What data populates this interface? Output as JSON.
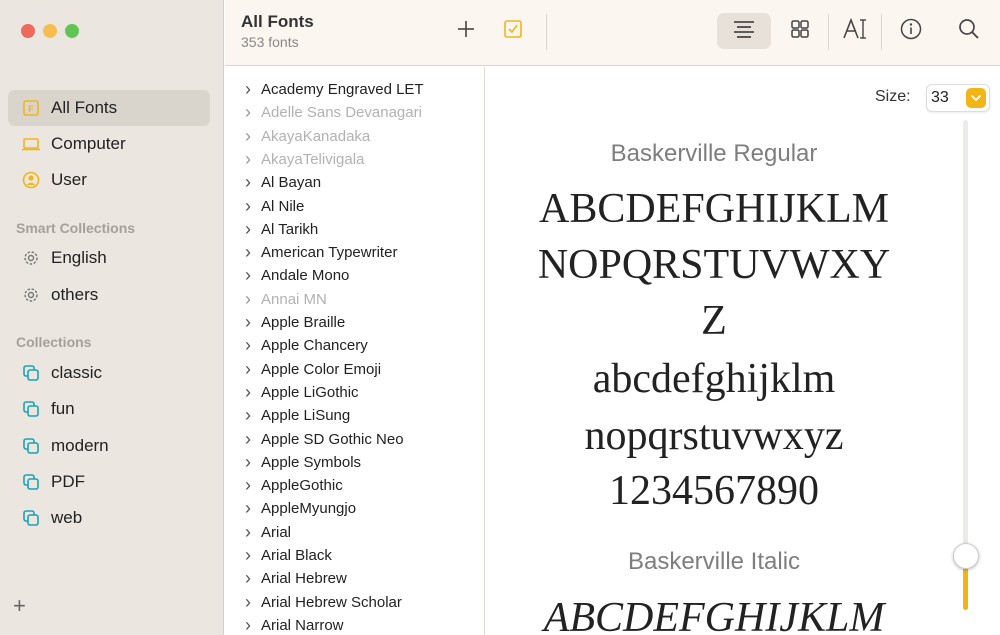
{
  "sidebar": {
    "main": [
      {
        "label": "All Fonts",
        "icon": "font-book-icon"
      },
      {
        "label": "Computer",
        "icon": "laptop-icon"
      },
      {
        "label": "User",
        "icon": "user-circle-icon"
      }
    ],
    "smart_heading": "Smart Collections",
    "smart": [
      {
        "label": "English",
        "icon": "gear-icon"
      },
      {
        "label": "others",
        "icon": "gear-icon"
      }
    ],
    "collections_heading": "Collections",
    "collections": [
      {
        "label": "classic",
        "icon": "collection-icon"
      },
      {
        "label": "fun",
        "icon": "collection-icon"
      },
      {
        "label": "modern",
        "icon": "collection-icon"
      },
      {
        "label": "PDF",
        "icon": "collection-icon"
      },
      {
        "label": "web",
        "icon": "collection-icon"
      }
    ],
    "add_label": "+"
  },
  "toolbar": {
    "title": "All Fonts",
    "subtitle": "353 fonts"
  },
  "fonts": [
    {
      "name": "Academy Engraved LET",
      "dim": false
    },
    {
      "name": "Adelle Sans Devanagari",
      "dim": true
    },
    {
      "name": "AkayaKanadaka",
      "dim": true
    },
    {
      "name": "AkayaTelivigala",
      "dim": true
    },
    {
      "name": "Al Bayan",
      "dim": false
    },
    {
      "name": "Al Nile",
      "dim": false
    },
    {
      "name": "Al Tarikh",
      "dim": false
    },
    {
      "name": "American Typewriter",
      "dim": false
    },
    {
      "name": "Andale Mono",
      "dim": false
    },
    {
      "name": "Annai MN",
      "dim": true
    },
    {
      "name": "Apple Braille",
      "dim": false
    },
    {
      "name": "Apple Chancery",
      "dim": false
    },
    {
      "name": "Apple Color Emoji",
      "dim": false
    },
    {
      "name": "Apple LiGothic",
      "dim": false
    },
    {
      "name": "Apple LiSung",
      "dim": false
    },
    {
      "name": "Apple SD Gothic Neo",
      "dim": false
    },
    {
      "name": "Apple Symbols",
      "dim": false
    },
    {
      "name": "AppleGothic",
      "dim": false
    },
    {
      "name": "AppleMyungjo",
      "dim": false
    },
    {
      "name": "Arial",
      "dim": false
    },
    {
      "name": "Arial Black",
      "dim": false
    },
    {
      "name": "Arial Hebrew",
      "dim": false
    },
    {
      "name": "Arial Hebrew Scholar",
      "dim": false
    },
    {
      "name": "Arial Narrow",
      "dim": false
    }
  ],
  "preview": {
    "size_label": "Size:",
    "size_value": "33",
    "size_fraction": 0.11,
    "regular_name": "Baskerville Regular",
    "regular_lines": [
      "ABCDEFGHIJKLM",
      "NOPQRSTUVWXY",
      "Z",
      "abcdefghijklm",
      "nopqrstuvwxyz",
      "1234567890"
    ],
    "italic_name": "Baskerville Italic",
    "italic_lines": [
      "ABCDEFGHIJKLM"
    ]
  },
  "colors": {
    "accent": "#f3b515",
    "sidebar_bg": "#ebe6df"
  }
}
